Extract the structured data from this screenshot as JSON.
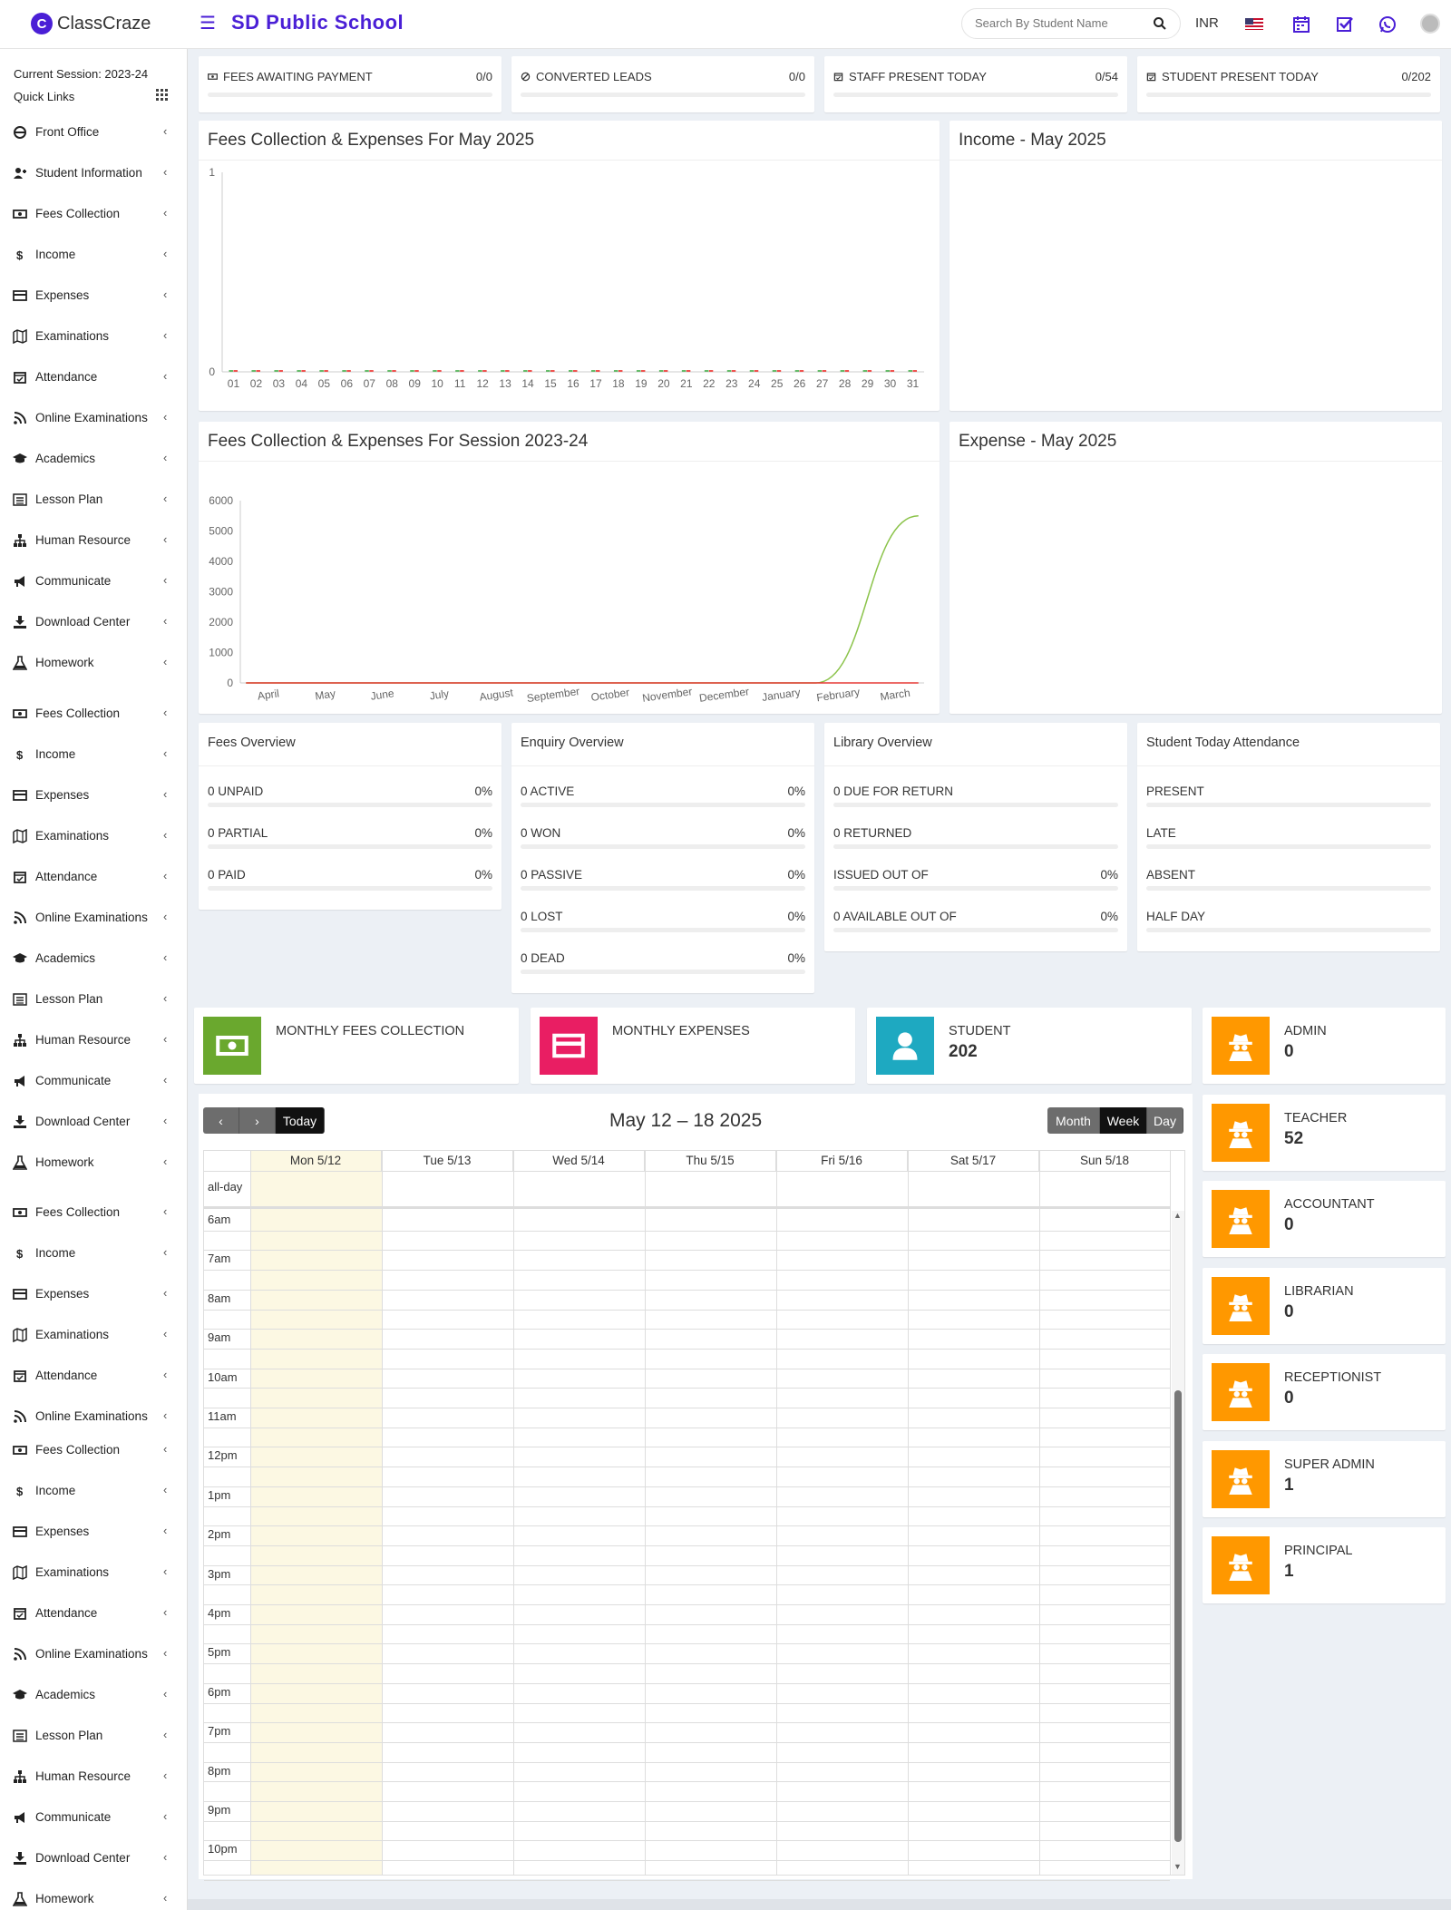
{
  "app": {
    "logo": "ClassCraze",
    "school": "SD Public School",
    "search_placeholder": "Search By Student Name",
    "currency": "INR"
  },
  "session": {
    "current": "Current Session: 2023-24",
    "quick_links": "Quick Links"
  },
  "sidebar": {
    "items": [
      {
        "label": "Front Office",
        "icon": "front-office-icon"
      },
      {
        "label": "Student Information",
        "icon": "student-info-icon"
      },
      {
        "label": "Fees Collection",
        "icon": "money-icon"
      },
      {
        "label": "Income",
        "icon": "dollar-icon"
      },
      {
        "label": "Expenses",
        "icon": "credit-card-icon"
      },
      {
        "label": "Examinations",
        "icon": "map-icon"
      },
      {
        "label": "Attendance",
        "icon": "calendar-check-icon"
      },
      {
        "label": "Online Examinations",
        "icon": "rss-icon"
      },
      {
        "label": "Academics",
        "icon": "graduation-cap-icon"
      },
      {
        "label": "Lesson Plan",
        "icon": "list-icon"
      },
      {
        "label": "Human Resource",
        "icon": "sitemap-icon"
      },
      {
        "label": "Communicate",
        "icon": "bullhorn-icon"
      },
      {
        "label": "Download Center",
        "icon": "download-icon"
      },
      {
        "label": "Homework",
        "icon": "flask-icon"
      },
      {
        "label": "Fees Collection",
        "icon": "money-icon"
      },
      {
        "label": "Income",
        "icon": "dollar-icon"
      },
      {
        "label": "Expenses",
        "icon": "credit-card-icon"
      },
      {
        "label": "Examinations",
        "icon": "map-icon"
      },
      {
        "label": "Attendance",
        "icon": "calendar-check-icon"
      },
      {
        "label": "Online Examinations",
        "icon": "rss-icon"
      },
      {
        "label": "Academics",
        "icon": "graduation-cap-icon"
      },
      {
        "label": "Lesson Plan",
        "icon": "list-icon"
      },
      {
        "label": "Human Resource",
        "icon": "sitemap-icon"
      },
      {
        "label": "Communicate",
        "icon": "bullhorn-icon"
      },
      {
        "label": "Download Center",
        "icon": "download-icon"
      },
      {
        "label": "Homework",
        "icon": "flask-icon"
      },
      {
        "label": "Fees Collection",
        "icon": "money-icon"
      },
      {
        "label": "Income",
        "icon": "dollar-icon"
      },
      {
        "label": "Expenses",
        "icon": "credit-card-icon"
      },
      {
        "label": "Examinations",
        "icon": "map-icon"
      },
      {
        "label": "Attendance",
        "icon": "calendar-check-icon"
      },
      {
        "label": "Online Examinations",
        "icon": "rss-icon"
      },
      {
        "label": "Fees Collection",
        "icon": "money-icon"
      },
      {
        "label": "Income",
        "icon": "dollar-icon"
      },
      {
        "label": "Expenses",
        "icon": "credit-card-icon"
      },
      {
        "label": "Examinations",
        "icon": "map-icon"
      },
      {
        "label": "Attendance",
        "icon": "calendar-check-icon"
      },
      {
        "label": "Online Examinations",
        "icon": "rss-icon"
      },
      {
        "label": "Academics",
        "icon": "graduation-cap-icon"
      },
      {
        "label": "Lesson Plan",
        "icon": "list-icon"
      },
      {
        "label": "Human Resource",
        "icon": "sitemap-icon"
      },
      {
        "label": "Communicate",
        "icon": "bullhorn-icon"
      },
      {
        "label": "Download Center",
        "icon": "download-icon"
      },
      {
        "label": "Homework",
        "icon": "flask-icon"
      }
    ]
  },
  "top_boxes": [
    {
      "label": "FEES AWAITING PAYMENT",
      "value": "0/0",
      "icon": "money-icon"
    },
    {
      "label": "CONVERTED LEADS",
      "value": "0/0",
      "icon": "ban-icon"
    },
    {
      "label": "STAFF PRESENT TODAY",
      "value": "0/54",
      "icon": "calendar-icon"
    },
    {
      "label": "STUDENT PRESENT TODAY",
      "value": "0/202",
      "icon": "calendar-icon"
    }
  ],
  "panels": {
    "monthly_chart_title": "Fees Collection & Expenses For May 2025",
    "income_title": "Income - May 2025",
    "session_chart_title": "Fees Collection & Expenses For Session 2023-24",
    "expense_title": "Expense - May 2025"
  },
  "chart_data": [
    {
      "type": "bar",
      "title": "Fees Collection & Expenses For May 2025",
      "categories": [
        "01",
        "02",
        "03",
        "04",
        "05",
        "06",
        "07",
        "08",
        "09",
        "10",
        "11",
        "12",
        "13",
        "14",
        "15",
        "16",
        "17",
        "18",
        "19",
        "20",
        "21",
        "22",
        "23",
        "24",
        "25",
        "26",
        "27",
        "28",
        "29",
        "30",
        "31"
      ],
      "series": [
        {
          "values": [
            0,
            0,
            0,
            0,
            0,
            0,
            0,
            0,
            0,
            0,
            0,
            0,
            0,
            0,
            0,
            0,
            0,
            0,
            0,
            0,
            0,
            0,
            0,
            0,
            0,
            0,
            0,
            0,
            0,
            0,
            0
          ],
          "color": "#66bb6a"
        },
        {
          "values": [
            0,
            0,
            0,
            0,
            0,
            0,
            0,
            0,
            0,
            0,
            0,
            0,
            0,
            0,
            0,
            0,
            0,
            0,
            0,
            0,
            0,
            0,
            0,
            0,
            0,
            0,
            0,
            0,
            0,
            0,
            0
          ],
          "color": "#ef5350"
        }
      ],
      "yticks": [
        "1",
        "0"
      ],
      "ylim": [
        0,
        1
      ]
    },
    {
      "type": "line",
      "title": "Fees Collection & Expenses For Session 2023-24",
      "categories": [
        "April",
        "May",
        "June",
        "July",
        "August",
        "September",
        "October",
        "November",
        "December",
        "January",
        "February",
        "March"
      ],
      "series": [
        {
          "values": [
            0,
            0,
            0,
            0,
            0,
            0,
            0,
            0,
            0,
            0,
            0,
            5500
          ],
          "color": "#8bc34a"
        },
        {
          "values": [
            0,
            0,
            0,
            0,
            0,
            0,
            0,
            0,
            0,
            0,
            0,
            0
          ],
          "color": "#e53935"
        }
      ],
      "yticks": [
        "6000",
        "5000",
        "4000",
        "3000",
        "2000",
        "1000",
        "0"
      ],
      "ylim": [
        0,
        6000
      ]
    }
  ],
  "overviews": [
    {
      "title": "Fees Overview",
      "rows": [
        {
          "label": "0 UNPAID",
          "value": "0%"
        },
        {
          "label": "0 PARTIAL",
          "value": "0%"
        },
        {
          "label": "0 PAID",
          "value": "0%"
        }
      ]
    },
    {
      "title": "Enquiry Overview",
      "rows": [
        {
          "label": "0 ACTIVE",
          "value": "0%"
        },
        {
          "label": "0 WON",
          "value": "0%"
        },
        {
          "label": "0 PASSIVE",
          "value": "0%"
        },
        {
          "label": "0 LOST",
          "value": "0%"
        },
        {
          "label": "0 DEAD",
          "value": "0%"
        }
      ]
    },
    {
      "title": "Library Overview",
      "rows": [
        {
          "label": "0 DUE FOR RETURN",
          "value": ""
        },
        {
          "label": "0 RETURNED",
          "value": ""
        },
        {
          "label": "ISSUED OUT OF",
          "value": "0%"
        },
        {
          "label": "0 AVAILABLE OUT OF",
          "value": "0%"
        }
      ]
    },
    {
      "title": "Student Today Attendance",
      "rows": [
        {
          "label": "PRESENT",
          "value": ""
        },
        {
          "label": "LATE",
          "value": ""
        },
        {
          "label": "ABSENT",
          "value": ""
        },
        {
          "label": "HALF DAY",
          "value": ""
        }
      ]
    }
  ],
  "info_boxes": [
    {
      "label": "MONTHLY FEES COLLECTION",
      "value": "",
      "color": "#6aa82e",
      "icon": "money-icon"
    },
    {
      "label": "MONTHLY EXPENSES",
      "value": "",
      "color": "#e91e63",
      "icon": "credit-card-icon"
    },
    {
      "label": "STUDENT",
      "value": "202",
      "color": "#1ea9c1",
      "icon": "user-icon"
    }
  ],
  "staff_boxes": [
    {
      "label": "ADMIN",
      "value": "0"
    },
    {
      "label": "TEACHER",
      "value": "52"
    },
    {
      "label": "ACCOUNTANT",
      "value": "0"
    },
    {
      "label": "LIBRARIAN",
      "value": "0"
    },
    {
      "label": "RECEPTIONIST",
      "value": "0"
    },
    {
      "label": "SUPER ADMIN",
      "value": "1"
    },
    {
      "label": "PRINCIPAL",
      "value": "1"
    }
  ],
  "staff_color": "#ff9800",
  "calendar": {
    "prev": "‹",
    "next": "›",
    "today": "Today",
    "title": "May 12 – 18 2025",
    "views": [
      "Month",
      "Week",
      "Day"
    ],
    "active_view": "Week",
    "days": [
      "Mon 5/12",
      "Tue 5/13",
      "Wed 5/14",
      "Thu 5/15",
      "Fri 5/16",
      "Sat 5/17",
      "Sun 5/18"
    ],
    "all_day": "all-day",
    "times": [
      "6am",
      "7am",
      "8am",
      "9am",
      "10am",
      "11am",
      "12pm",
      "1pm",
      "2pm",
      "3pm",
      "4pm",
      "5pm",
      "6pm",
      "7pm",
      "8pm",
      "9pm",
      "10pm"
    ]
  }
}
